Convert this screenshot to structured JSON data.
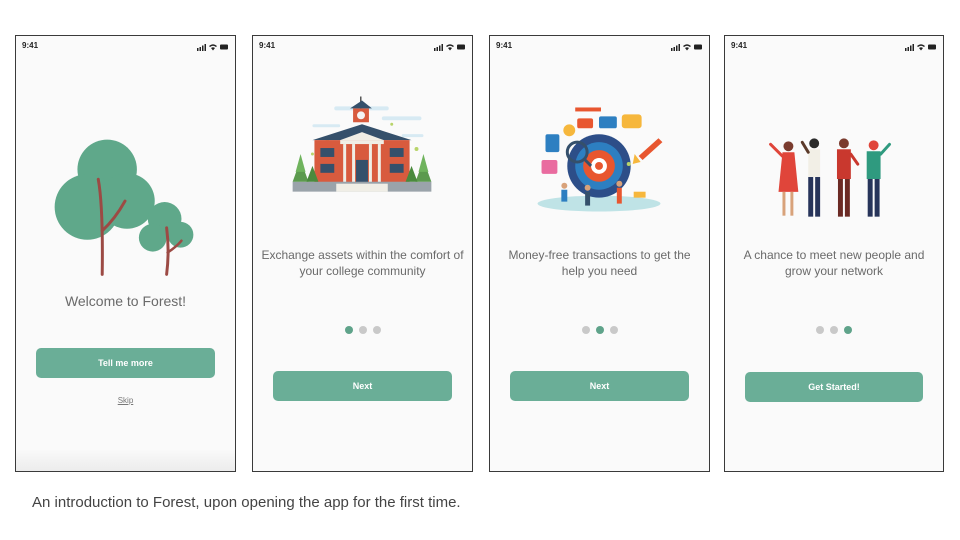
{
  "screens": [
    {
      "time": "9:41",
      "title": "Welcome to  Forest!",
      "button_label": "Tell me more",
      "skip_label": "Skip",
      "illustration": "tree-illustration"
    },
    {
      "time": "9:41",
      "caption": "Exchange assets within the comfort of your college community",
      "button_label": "Next",
      "active_dot": 1,
      "illustration": "college-building-illustration"
    },
    {
      "time": "9:41",
      "caption": "Money-free transactions to get the help you need",
      "button_label": "Next",
      "active_dot": 2,
      "illustration": "target-teamwork-illustration"
    },
    {
      "time": "9:41",
      "caption": "A chance to meet new people and grow your network",
      "button_label": "Get Started!",
      "active_dot": 3,
      "illustration": "people-group-illustration"
    }
  ],
  "footnote": "An introduction to Forest, upon opening the app for the first time.",
  "colors": {
    "accent": "#6aae97",
    "active_dot": "#5fa38a",
    "inactive_dot": "#c9c9c9",
    "tree_crown": "#5fa88a",
    "tree_trunk": "#9c4a44"
  }
}
